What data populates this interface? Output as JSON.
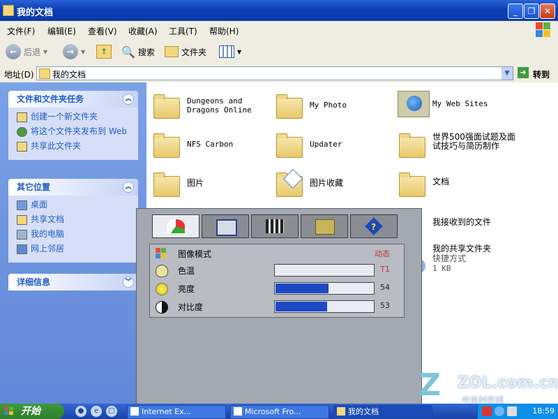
{
  "window": {
    "title": "我的文档",
    "buttons": {
      "minimize": "_",
      "maximize": "❐",
      "close": "✕"
    }
  },
  "menu": [
    "文件(F)",
    "编辑(E)",
    "查看(V)",
    "收藏(A)",
    "工具(T)",
    "帮助(H)"
  ],
  "toolbar": {
    "back": "后退",
    "search": "搜索",
    "folders": "文件夹"
  },
  "address": {
    "label": "地址(D)",
    "value": "我的文档",
    "go": "转到"
  },
  "left": {
    "tasks": {
      "title": "文件和文件夹任务",
      "items": [
        "创建一个新文件夹",
        "将这个文件夹发布到 Web",
        "共享此文件夹"
      ]
    },
    "places": {
      "title": "其它位置",
      "items": [
        "桌面",
        "共享文档",
        "我的电脑",
        "网上邻居"
      ]
    },
    "details": {
      "title": "详细信息"
    }
  },
  "files": {
    "dungeons": "Dungeons and Dragons Online",
    "myphoto": "My Photo",
    "websites": "My Web Sites",
    "nfs": "NFS Carbon",
    "updater": "Updater",
    "top500": "世界500强面试题及面试技巧与简历制作",
    "pictures": "图片",
    "pic_fav": "图片收藏",
    "docs": "文档",
    "received": "我接收到的文件",
    "shared": "我的共享文件夹",
    "shared_type": "快捷方式",
    "shared_size": "1 KB"
  },
  "osd": {
    "rows": [
      {
        "label": "图像模式",
        "value": "动态"
      },
      {
        "label": "色温",
        "value": "T1"
      },
      {
        "label": "亮度",
        "value": "54",
        "level": 54
      },
      {
        "label": "对比度",
        "value": "53",
        "level": 53
      }
    ]
  },
  "taskbar": {
    "start": "开始",
    "tasks": [
      "Internet Ex...",
      "Microsoft Fro...",
      "我的文档"
    ],
    "clock": "18:59"
  },
  "watermark": {
    "site": "ZOL.com.cn",
    "cn": "中关村在线"
  },
  "colors": {
    "xp_blue": "#0b3fb8",
    "osd_bar": "#1c48c4",
    "osd_value": "#b33333"
  }
}
